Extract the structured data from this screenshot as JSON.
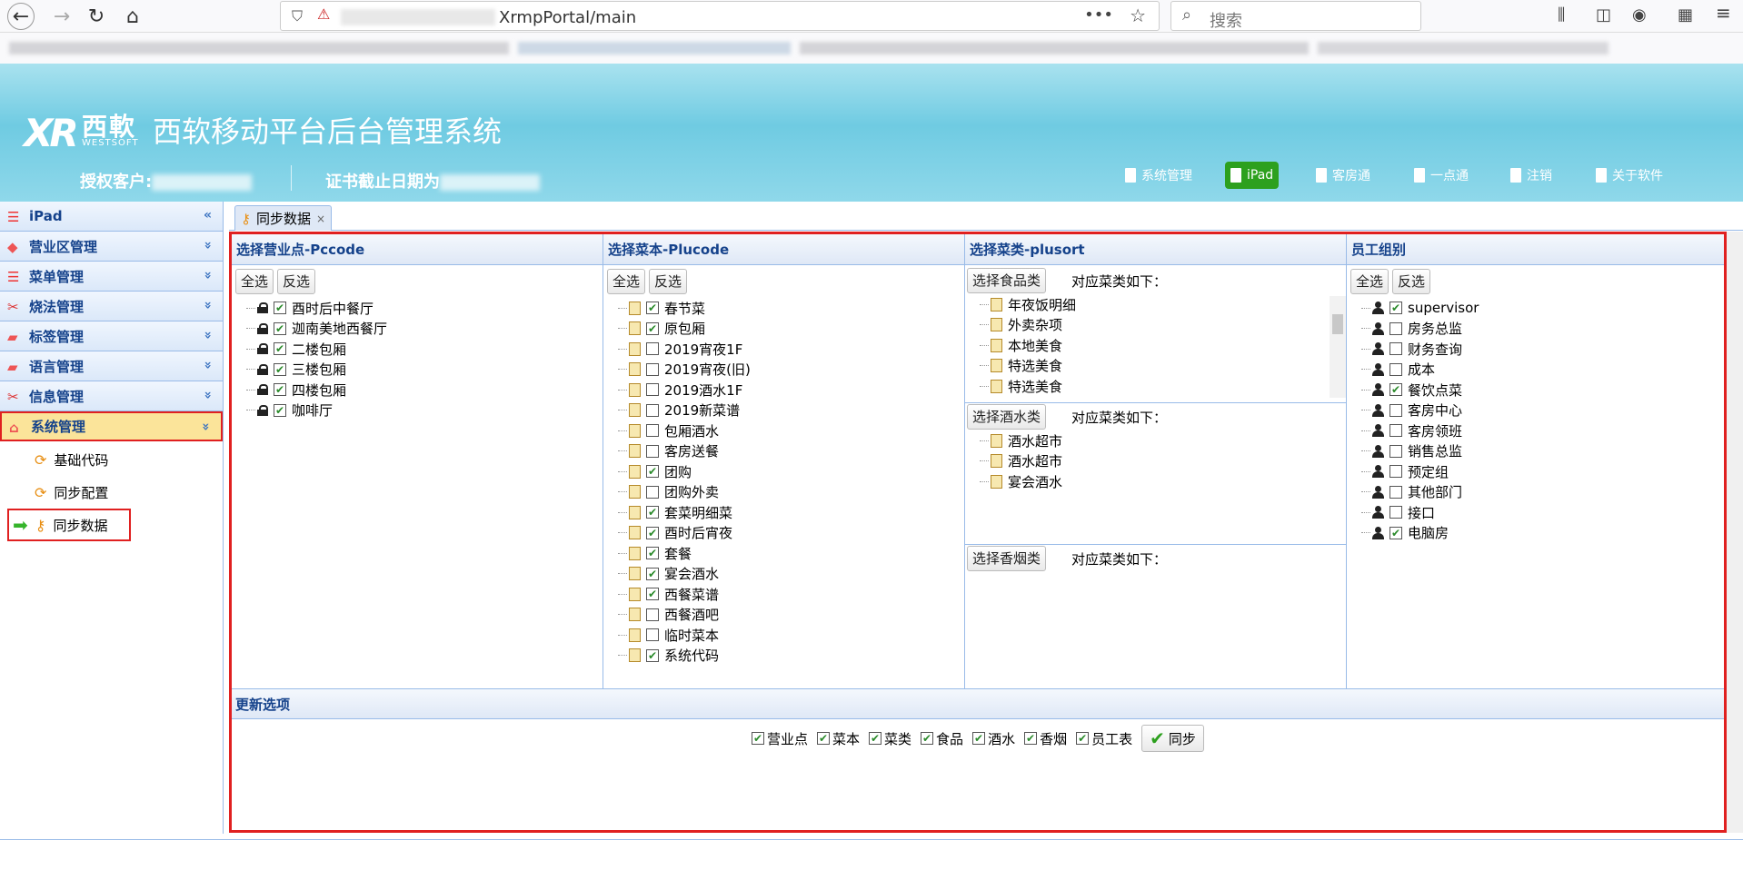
{
  "browser": {
    "url_suffix": "XrmpPortal/main",
    "search_placeholder": "搜索"
  },
  "header": {
    "logo_cn": "西軟",
    "logo_en": "WESTSOFT",
    "title": "西软移动平台后台管理系统",
    "license_label": "授权客户:",
    "expire_label": "证书截止日期为",
    "nav": [
      {
        "label": "系统管理",
        "active": false
      },
      {
        "label": "iPad",
        "active": true
      },
      {
        "label": "客房通",
        "active": false
      },
      {
        "label": "一点通",
        "active": false
      },
      {
        "label": "注销",
        "active": false
      },
      {
        "label": "关于软件",
        "active": false
      }
    ]
  },
  "sidebar": {
    "items": [
      {
        "label": "iPad",
        "icon": "list-icon",
        "chev": "«"
      },
      {
        "label": "营业区管理",
        "icon": "tag-icon",
        "chev": "»"
      },
      {
        "label": "菜单管理",
        "icon": "list-icon",
        "chev": "»"
      },
      {
        "label": "烧法管理",
        "icon": "tools-icon",
        "chev": "»"
      },
      {
        "label": "标签管理",
        "icon": "tags-icon",
        "chev": "»"
      },
      {
        "label": "语言管理",
        "icon": "tags-icon",
        "chev": "»"
      },
      {
        "label": "信息管理",
        "icon": "tools-icon",
        "chev": "»"
      },
      {
        "label": "系统管理",
        "icon": "home-icon",
        "chev": "«"
      }
    ],
    "sub_items": [
      {
        "label": "基础代码"
      },
      {
        "label": "同步配置"
      },
      {
        "label": "同步数据"
      }
    ]
  },
  "tab": {
    "label": "同步数据",
    "close": "×"
  },
  "buttons": {
    "select_all": "全选",
    "invert": "反选"
  },
  "pccode": {
    "title": "选择营业点-Pccode",
    "items": [
      {
        "label": "酉时后中餐厅",
        "checked": true
      },
      {
        "label": "迦南美地西餐厅",
        "checked": true
      },
      {
        "label": "二楼包厢",
        "checked": true
      },
      {
        "label": "三楼包厢",
        "checked": true
      },
      {
        "label": "四楼包厢",
        "checked": true
      },
      {
        "label": "咖啡厅",
        "checked": true
      }
    ]
  },
  "plucode": {
    "title": "选择菜本-Plucode",
    "items": [
      {
        "label": "春节菜",
        "checked": true
      },
      {
        "label": "原包厢",
        "checked": true
      },
      {
        "label": "2019宵夜1F",
        "checked": false
      },
      {
        "label": "2019宵夜(旧)",
        "checked": false
      },
      {
        "label": "2019酒水1F",
        "checked": false
      },
      {
        "label": "2019新菜谱",
        "checked": false
      },
      {
        "label": "包厢酒水",
        "checked": false
      },
      {
        "label": "客房送餐",
        "checked": false
      },
      {
        "label": "团购",
        "checked": true
      },
      {
        "label": "团购外卖",
        "checked": false
      },
      {
        "label": "套菜明细菜",
        "checked": true
      },
      {
        "label": "酉时后宵夜",
        "checked": true
      },
      {
        "label": "套餐",
        "checked": true
      },
      {
        "label": "宴会酒水",
        "checked": true
      },
      {
        "label": "西餐菜谱",
        "checked": true
      },
      {
        "label": "西餐酒吧",
        "checked": false
      },
      {
        "label": "临时菜本",
        "checked": false
      },
      {
        "label": "系统代码",
        "checked": true
      }
    ]
  },
  "plusort": {
    "title": "选择菜类-plusort",
    "corresponding_label": "对应菜类如下：",
    "food": {
      "button": "选择食品类",
      "items": [
        "年夜饭明细",
        "外卖杂项",
        "本地美食",
        "特选美食",
        "特选美食"
      ]
    },
    "drink": {
      "button": "选择酒水类",
      "items": [
        "酒水超市",
        "酒水超市",
        "宴会酒水"
      ]
    },
    "tobacco": {
      "button": "选择香烟类",
      "items": []
    }
  },
  "staff": {
    "title": "员工组别",
    "items": [
      {
        "label": "supervisor",
        "checked": true
      },
      {
        "label": "房务总监",
        "checked": false
      },
      {
        "label": "财务查询",
        "checked": false
      },
      {
        "label": "成本",
        "checked": false
      },
      {
        "label": "餐饮点菜",
        "checked": true
      },
      {
        "label": "客房中心",
        "checked": false
      },
      {
        "label": "客房领班",
        "checked": false
      },
      {
        "label": "销售总监",
        "checked": false
      },
      {
        "label": "预定组",
        "checked": false
      },
      {
        "label": "其他部门",
        "checked": false
      },
      {
        "label": "接口",
        "checked": false
      },
      {
        "label": "电脑房",
        "checked": true
      }
    ]
  },
  "update": {
    "title": "更新选项",
    "options": [
      {
        "label": "营业点",
        "checked": true
      },
      {
        "label": "菜本",
        "checked": true
      },
      {
        "label": "菜类",
        "checked": true
      },
      {
        "label": "食品",
        "checked": true
      },
      {
        "label": "酒水",
        "checked": true
      },
      {
        "label": "香烟",
        "checked": true
      },
      {
        "label": "员工表",
        "checked": true
      }
    ],
    "sync_label": "同步"
  }
}
